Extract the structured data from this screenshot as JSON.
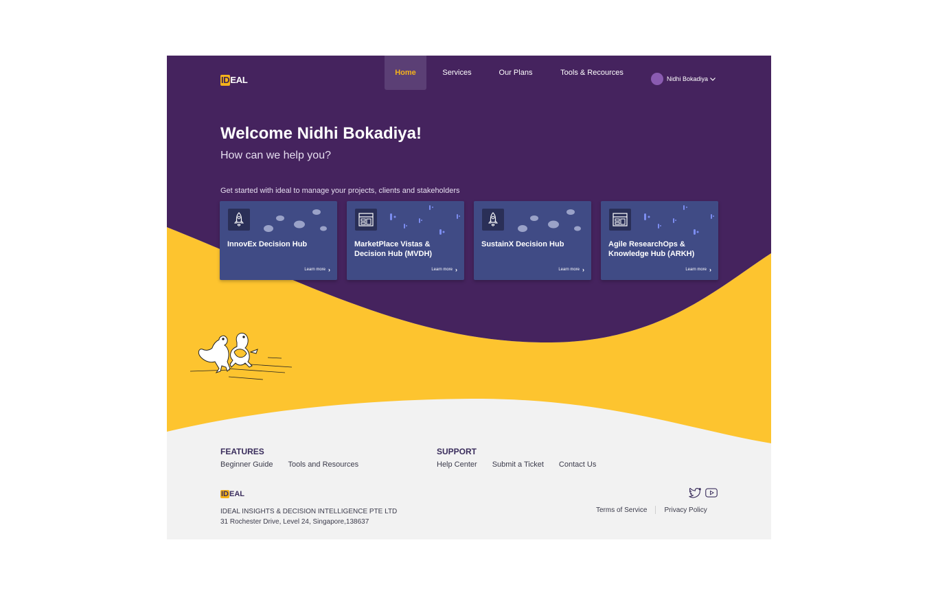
{
  "brand": {
    "logo_highlight": "ID",
    "logo_rest": "EAL"
  },
  "nav": {
    "items": [
      {
        "label": "Home",
        "active": true
      },
      {
        "label": "Services",
        "active": false
      },
      {
        "label": "Our Plans",
        "active": false
      },
      {
        "label": "Tools & Recources",
        "active": false
      }
    ],
    "user_name": "Nidhi Bokadiya"
  },
  "hero": {
    "welcome": "Welcome Nidhi Bokadiya!",
    "subtitle": "How can we help you?",
    "get_started": "Get started with ideal to manage your projects, clients and stakeholders"
  },
  "cards": [
    {
      "title": "InnovEx Decision Hub",
      "icon": "rocket-icon",
      "cta": "Learn more"
    },
    {
      "title": "MarketPlace Vistas & Decision Hub (MVDH)",
      "icon": "layout-icon",
      "cta": "Learn more"
    },
    {
      "title": "SustainX Decision Hub",
      "icon": "rocket-icon",
      "cta": "Learn more"
    },
    {
      "title": "Agile  ResearchOps & Knowledge Hub (ARKH)",
      "icon": "layout-icon",
      "cta": "Learn more"
    }
  ],
  "footer": {
    "features_heading": "FEATURES",
    "features_links": [
      "Beginner Guide",
      "Tools and Resources"
    ],
    "support_heading": "SUPPORT",
    "support_links": [
      "Help Center",
      "Submit a Ticket",
      "Contact Us"
    ],
    "company_name": "IDEAL INSIGHTS & DECISION INTELLIGENCE PTE LTD",
    "company_address": "31 Rochester Drive, Level 24, Singapore,138637",
    "terms": "Terms of Service",
    "privacy": "Privacy Policy",
    "social_icons": [
      "twitter-icon",
      "youtube-icon"
    ]
  },
  "colors": {
    "purple": "#45235e",
    "yellow": "#fdc42f",
    "card": "#404b85",
    "accent": "#f5b21b"
  }
}
